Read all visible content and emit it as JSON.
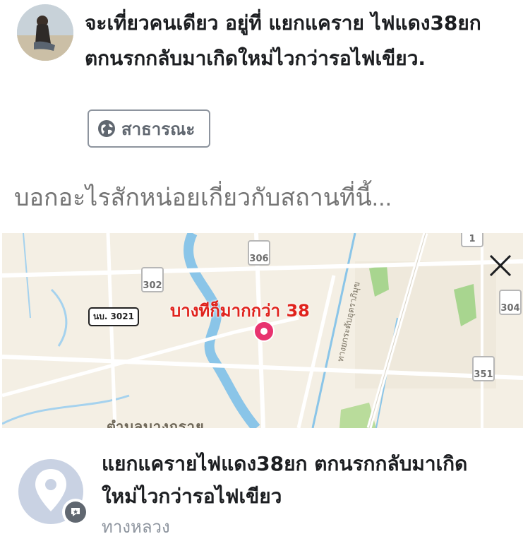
{
  "status": {
    "text": "จะเที่ยวคนเดียว อยู่ที่ แยกแคราย ไฟแดง38ยก ตกนรกกลับมาเกิดใหม่ไวกว่ารอไฟเขียว."
  },
  "privacy": {
    "label": "สาธารณะ",
    "icon": "globe-icon"
  },
  "comment": {
    "placeholder": "บอกอะไรสักหน่อยเกี่ยวกับสถานที่นี้..."
  },
  "map": {
    "pin_label": "บางทีก็มากกว่า 38",
    "road_labels": [
      "306",
      "302",
      "304",
      "351",
      "1"
    ],
    "local_road_label": "นบ. 3021",
    "area_label": "ตำบลบางกราย",
    "street_label": "ทางยกระดับอุตราภิมุข",
    "colors": {
      "pin": "#e8336f",
      "label": "#e0231d",
      "river": "#8ac5e8"
    },
    "close_icon": "close-icon"
  },
  "place": {
    "name": "แยกแครายไฟแดง38ยก ตกนรกกลับมาเกิดใหม่ไวกว่ารอไฟเขียว",
    "subtitle": "ทางหลวง",
    "icon": "location-pin-icon"
  }
}
